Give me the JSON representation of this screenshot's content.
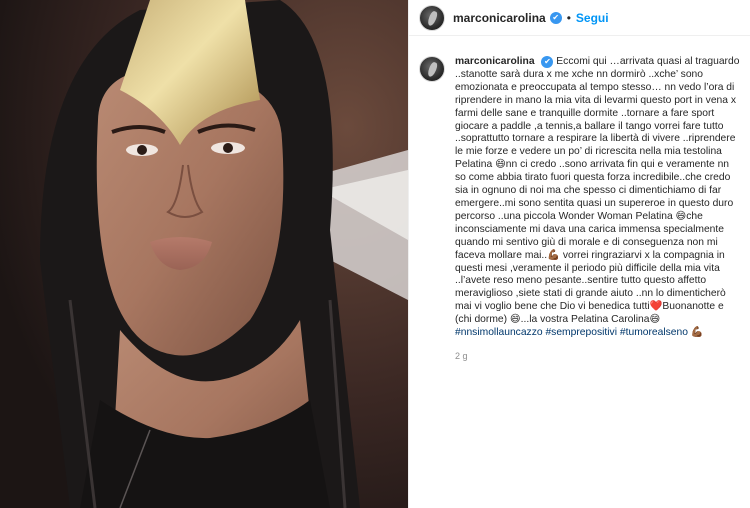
{
  "post": {
    "username": "marconicarolina",
    "verified_mark": "✔",
    "separator": "•",
    "follow_label": "Segui",
    "caption": {
      "username": "marconicarolina",
      "text": "Eccomi qui …arrivata quasi al traguardo ..stanotte sarà dura x me xche nn dormirò ..xche’ sono emozionata e preoccupata al tempo stesso… nn vedo l’ora di riprendere in mano la mia vita di levarmi questo port in vena x farmi delle sane e tranquille dormite ..tornare a fare sport giocare a paddle ,a tennis,a ballare il tango vorrei fare tutto ..soprattutto tornare a respirare la libertà di vivere ..riprendere le mie forze e vedere un po’ di ricrescita nella mia testolina Pelatina 😄nn ci credo ..sono arrivata fin qui e veramente nn so come abbia tirato fuori questa forza incredibile..che credo sia in ognuno di noi ma che spesso ci dimentichiamo di far emergere..mi sono sentita quasi un supereroe in questo duro percorso ..una piccola Wonder Woman Pelatina 😄che inconsciamente mi dava una carica immensa specialmente quando mi sentivo giù di morale e di conseguenza non mi faceva mollare mai..💪🏾 vorrei ringraziarvi x la compagnia in questi mesi ,veramente il periodo più difficile della mia vita ..l’avete reso meno pesante..sentire tutto questo affetto meraviglioso ,siete stati di grande aiuto ..nn lo dimenticherò mai vi voglio bene che Dio vi benedica tutti❤️Buonanotte e (chi dorme) 😄...la vostra Pelatina Carolina😄",
      "hashtags": [
        "#nnsimollauncazzo",
        "#semprepositivi",
        "#tumorealseno"
      ],
      "trailing_emoji": "💪🏾",
      "timestamp": "2 g"
    },
    "icons": {
      "avatar": "avatar-icon",
      "verified": "verified-badge-icon"
    }
  }
}
